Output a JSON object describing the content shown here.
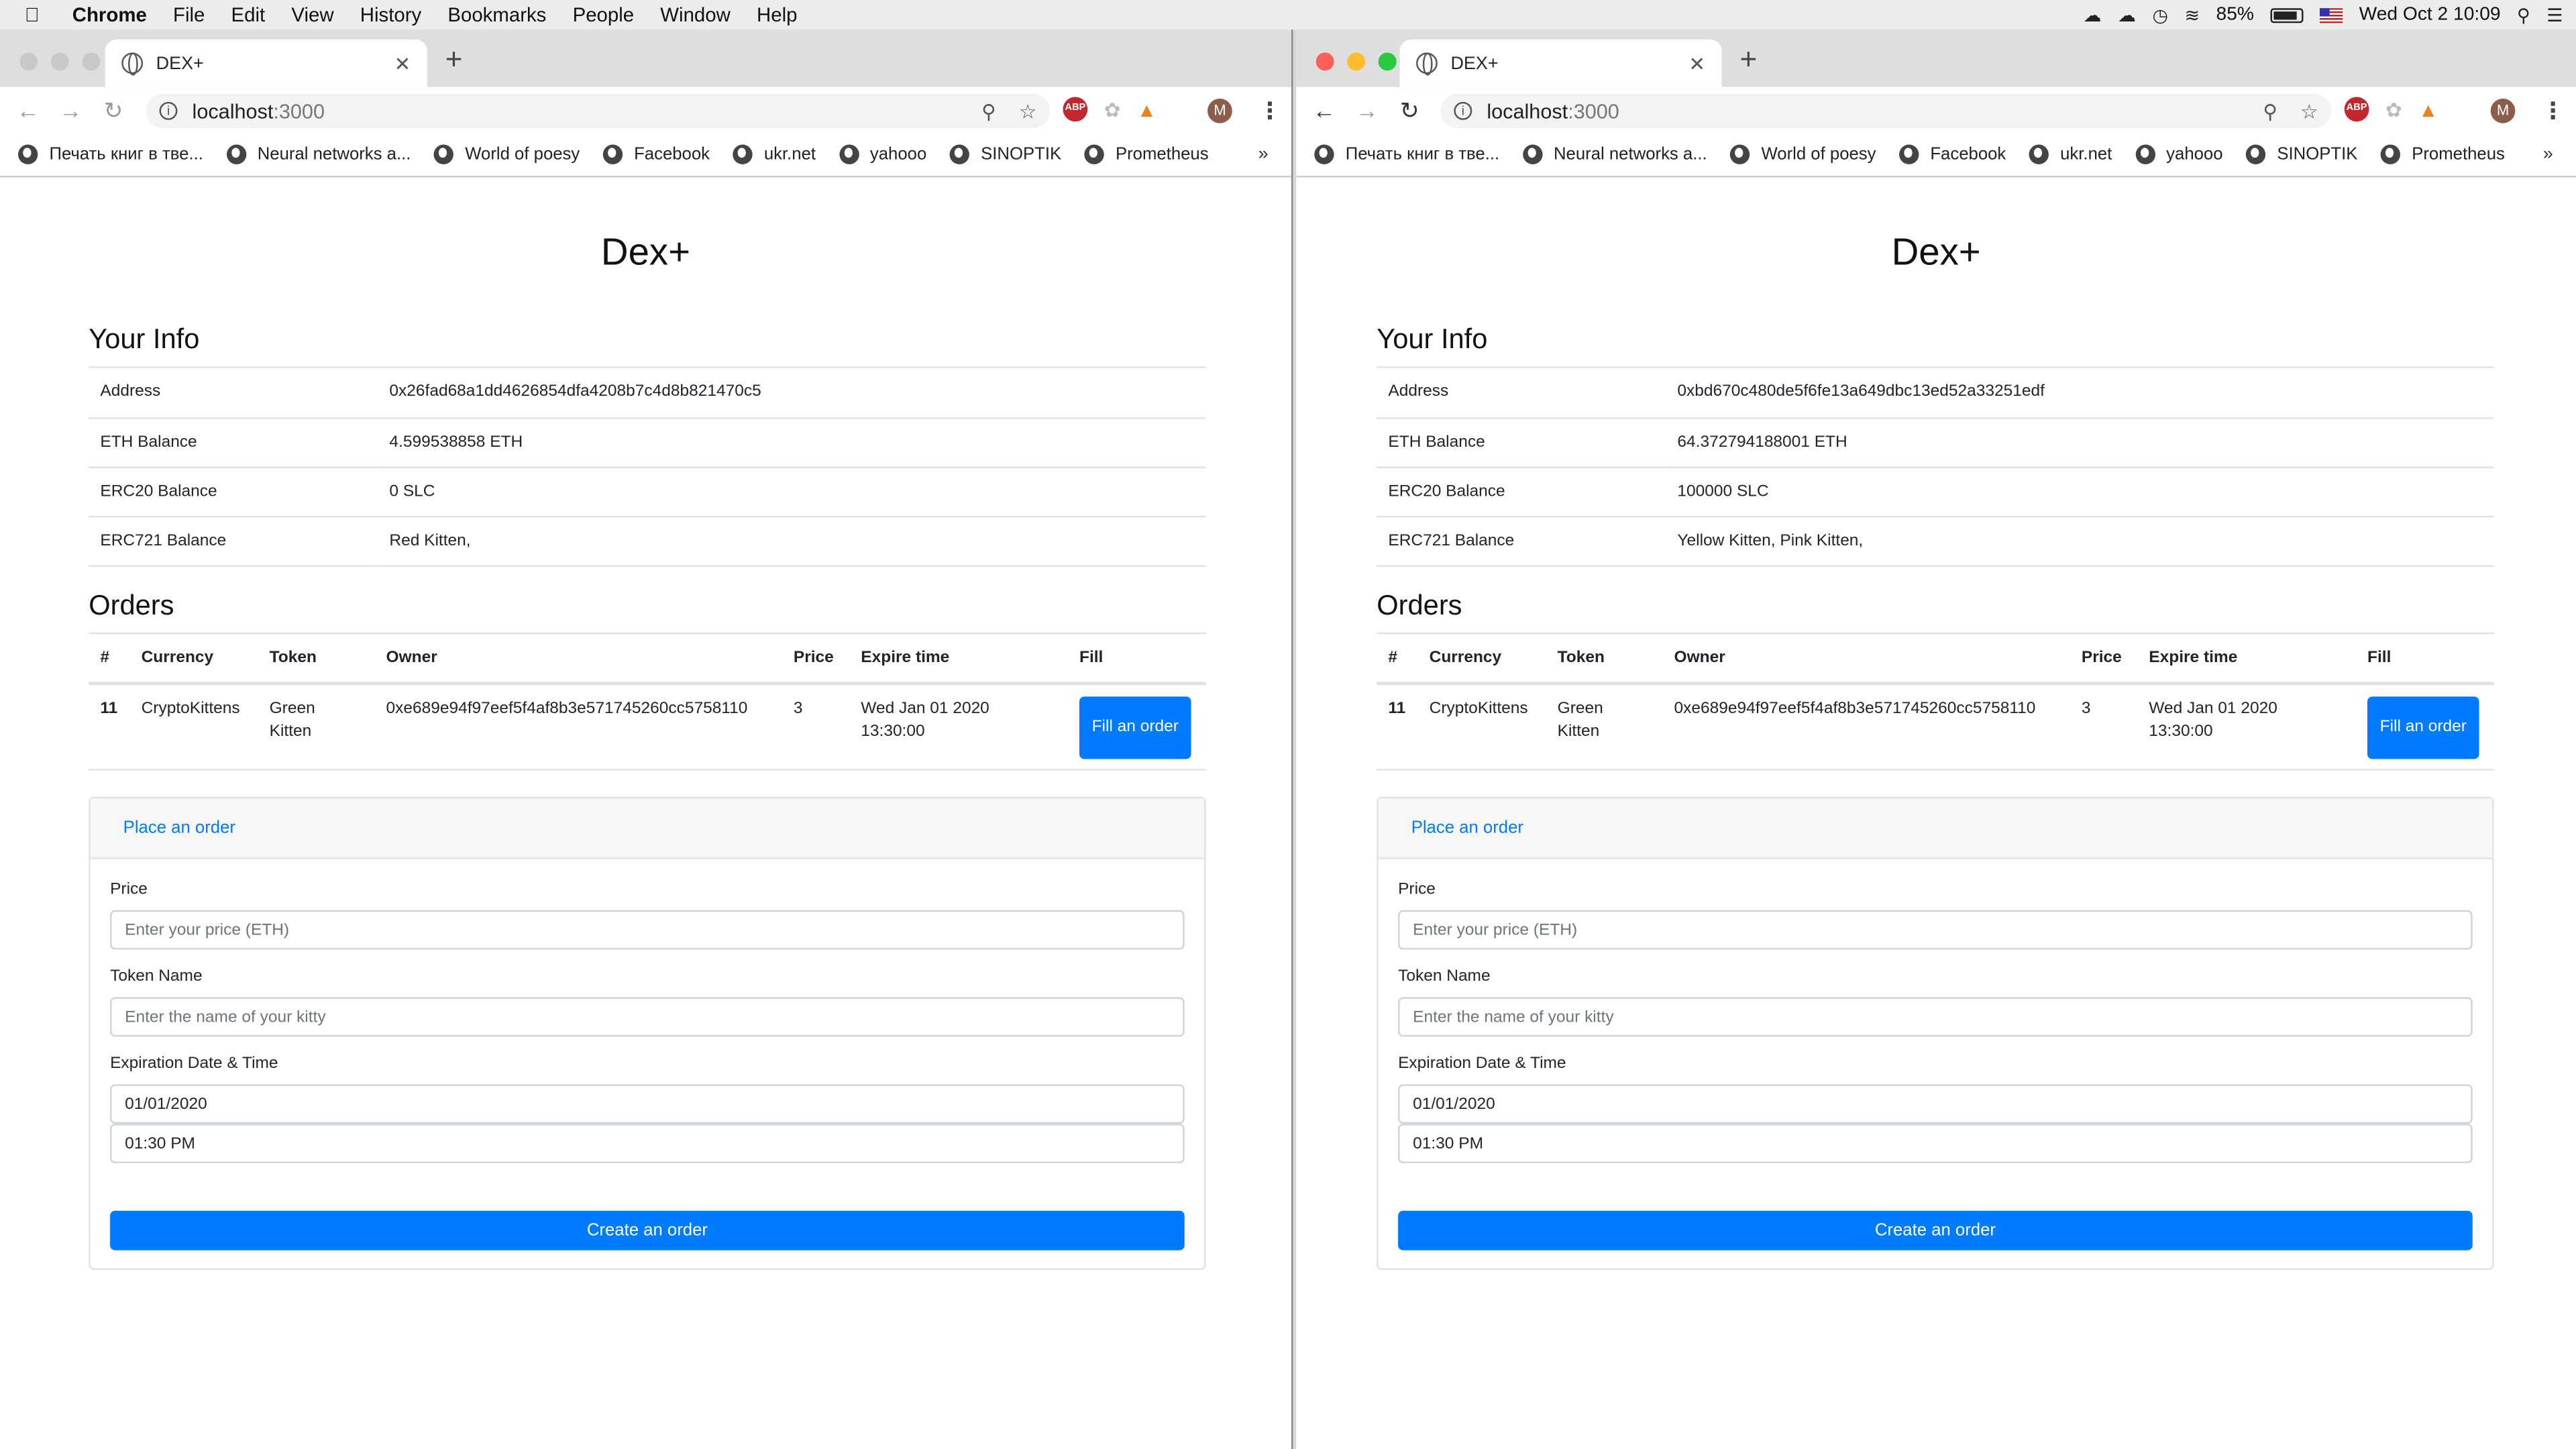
{
  "menubar": {
    "app": "Chrome",
    "items": [
      "File",
      "Edit",
      "View",
      "History",
      "Bookmarks",
      "People",
      "Window",
      "Help"
    ],
    "battery": "85%",
    "datetime": "Wed Oct 2  10:09"
  },
  "windows": [
    {
      "tab_title": "DEX+",
      "url_host": "localhost",
      "url_port": ":3000",
      "bookmarks": [
        "Печать книг в тве...",
        "Neural networks a...",
        "World of poesy",
        "Facebook",
        "ukr.net",
        "yahooo",
        "SINOPTIK",
        "Prometheus"
      ],
      "page": {
        "title": "Dex+",
        "your_info_heading": "Your Info",
        "info_rows": [
          {
            "label": "Address",
            "value": "0x26fad68a1dd4626854dfa4208b7c4d8b821470c5"
          },
          {
            "label": "ETH Balance",
            "value": "4.599538858 ETH"
          },
          {
            "label": "ERC20 Balance",
            "value": "0 SLC"
          },
          {
            "label": "ERC721 Balance",
            "value": "Red Kitten,"
          }
        ],
        "orders_heading": "Orders",
        "orders_columns": [
          "#",
          "Currency",
          "Token",
          "Owner",
          "Price",
          "Expire time",
          "Fill"
        ],
        "orders": [
          {
            "id": "11",
            "currency": "CryptoKittens",
            "token": "Green Kitten",
            "owner": "0xe689e94f97eef5f4af8b3e571745260cc5758110",
            "price": "3",
            "expire": "Wed Jan 01 2020 13:30:00",
            "fill_label": "Fill an order"
          }
        ],
        "form": {
          "header": "Place an order",
          "price_label": "Price",
          "price_placeholder": "Enter your price (ETH)",
          "token_label": "Token Name",
          "token_placeholder": "Enter the name of your kitty",
          "expiration_label": "Expiration Date & Time",
          "date_value": "01/01/2020",
          "time_value": "01:30 PM",
          "submit_label": "Create an order"
        }
      }
    },
    {
      "tab_title": "DEX+",
      "url_host": "localhost",
      "url_port": ":3000",
      "bookmarks": [
        "Печать книг в тве...",
        "Neural networks a...",
        "World of poesy",
        "Facebook",
        "ukr.net",
        "yahooo",
        "SINOPTIK",
        "Prometheus"
      ],
      "page": {
        "title": "Dex+",
        "your_info_heading": "Your Info",
        "info_rows": [
          {
            "label": "Address",
            "value": "0xbd670c480de5f6fe13a649dbc13ed52a33251edf"
          },
          {
            "label": "ETH Balance",
            "value": "64.372794188001 ETH"
          },
          {
            "label": "ERC20 Balance",
            "value": "100000 SLC"
          },
          {
            "label": "ERC721 Balance",
            "value": "Yellow Kitten, Pink Kitten,"
          }
        ],
        "orders_heading": "Orders",
        "orders_columns": [
          "#",
          "Currency",
          "Token",
          "Owner",
          "Price",
          "Expire time",
          "Fill"
        ],
        "orders": [
          {
            "id": "11",
            "currency": "CryptoKittens",
            "token": "Green Kitten",
            "owner": "0xe689e94f97eef5f4af8b3e571745260cc5758110",
            "price": "3",
            "expire": "Wed Jan 01 2020 13:30:00",
            "fill_label": "Fill an order"
          }
        ],
        "form": {
          "header": "Place an order",
          "price_label": "Price",
          "price_placeholder": "Enter your price (ETH)",
          "token_label": "Token Name",
          "token_placeholder": "Enter the name of your kitty",
          "expiration_label": "Expiration Date & Time",
          "date_value": "01/01/2020",
          "time_value": "01:30 PM",
          "submit_label": "Create an order"
        }
      }
    }
  ]
}
